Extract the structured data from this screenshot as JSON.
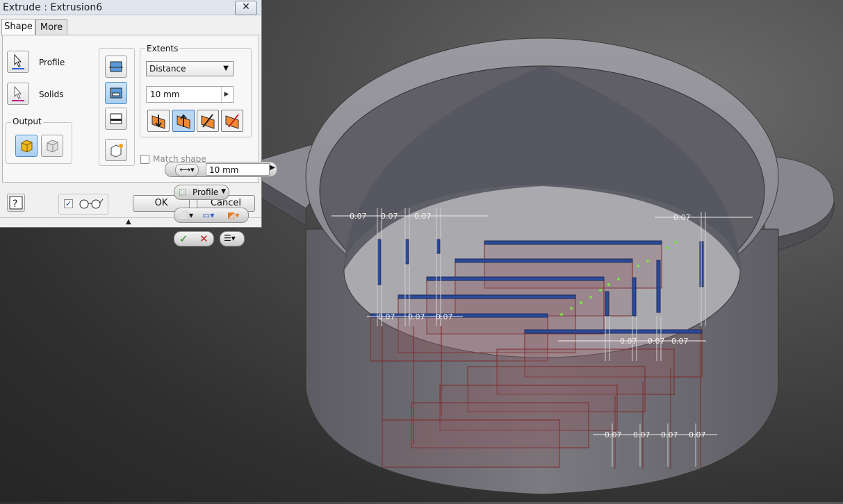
{
  "dialog": {
    "title": "Extrude : Extrusion6",
    "close": "✕",
    "tabs": [
      {
        "label": "Shape"
      },
      {
        "label": "More"
      }
    ],
    "profile_label": "Profile",
    "solids_label": "Solids",
    "output_label": "Output",
    "extents_label": "Extents",
    "extents_type": "Distance",
    "distance_value": "10 mm",
    "match_shape_label": "Match shape",
    "ok_label": "OK",
    "cancel_label": "Cancel",
    "preview_checked": true
  },
  "mini_toolbar": {
    "distance_value": "10 mm",
    "profile_label": "Profile"
  },
  "dimensions": {
    "value": "0.07"
  },
  "colors": {
    "part_body": "#8a8a90",
    "sketch_blue": "#2c4a9a",
    "sketch_red": "#8a2a2a",
    "accent": "#4c8cc4"
  },
  "icons": [
    "select-arrow-icon",
    "output-solid-icon",
    "output-surface-icon",
    "join-icon",
    "cut-icon",
    "intersect-icon",
    "new-solid-icon",
    "direction-icon",
    "help-icon",
    "glasses-icon",
    "checkmark-icon",
    "cross-icon"
  ]
}
